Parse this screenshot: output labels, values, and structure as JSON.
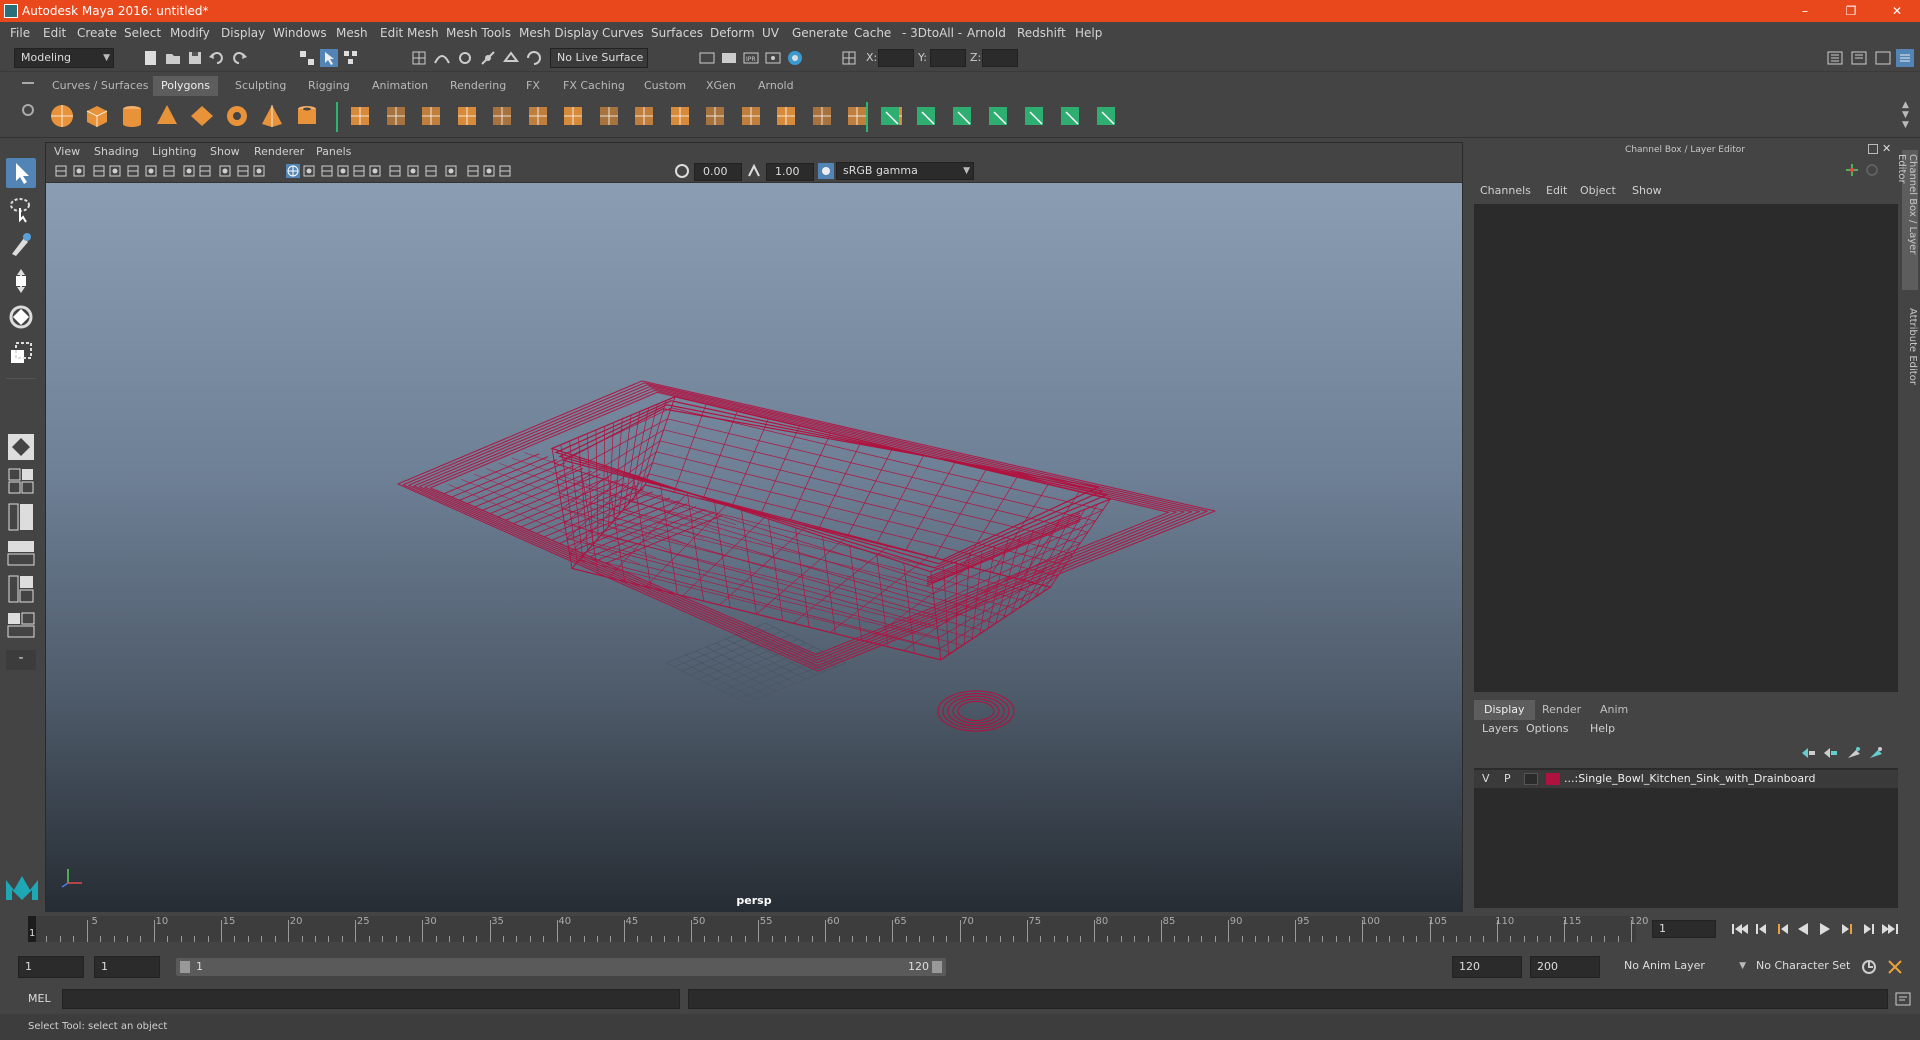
{
  "window": {
    "title": "Autodesk Maya 2016: untitled*",
    "controls": [
      "–",
      "❐",
      "✕"
    ]
  },
  "menubar": [
    "File",
    "Edit",
    "Create",
    "Select",
    "Modify",
    "Display",
    "Windows",
    "Mesh",
    "Edit Mesh",
    "Mesh Tools",
    "Mesh Display",
    "Curves",
    "Surfaces",
    "Deform",
    "UV",
    "Generate",
    "Cache",
    "- 3DtoAll -",
    "Arnold",
    "Redshift",
    "Help"
  ],
  "statusline": {
    "menuset": "Modeling",
    "live_surface": "No Live Surface",
    "x_label": "X:",
    "y_label": "Y:",
    "z_label": "Z:"
  },
  "shelf_tabs": [
    "Curves / Surfaces",
    "Polygons",
    "Sculpting",
    "Rigging",
    "Animation",
    "Rendering",
    "FX",
    "FX Caching",
    "Custom",
    "XGen",
    "Arnold"
  ],
  "shelf_active": "Polygons",
  "shelf_icon_names": [
    "sphere-icon",
    "cube-icon",
    "cylinder-icon",
    "cone-icon",
    "plane-icon",
    "torus-icon",
    "pyramid-icon",
    "pipe-icon",
    "combine-icon",
    "separate-icon",
    "extract-icon",
    "smooth-icon",
    "boolean-icon",
    "mirror-icon",
    "bevel-icon",
    "bridge-icon",
    "extrude-icon",
    "multicut-icon",
    "insert-edge-loop-icon",
    "append-icon",
    "fill-hole-icon",
    "target-weld-icon",
    "quad-draw-icon",
    "crease-icon",
    "uv-planar-icon",
    "uv-auto-icon",
    "uv-cylindrical-icon",
    "uv-spherical-icon",
    "uv-editor-icon",
    "uv-unfold-icon",
    "uv-layout-icon"
  ],
  "viewport": {
    "menu": [
      "View",
      "Shading",
      "Lighting",
      "Show",
      "Renderer",
      "Panels"
    ],
    "exposure": "0.00",
    "gamma": "1.00",
    "color_space": "sRGB gamma",
    "camera_label": "persp",
    "wire_color": "#b0123f"
  },
  "right_panel": {
    "header": "Channel Box / Layer Editor",
    "menu": [
      "Channels",
      "Edit",
      "Object",
      "Show"
    ],
    "tabs": [
      "Display",
      "Render",
      "Anim"
    ],
    "active_tab": "Display",
    "layer_menu": [
      "Layers",
      "Options",
      "Help"
    ],
    "layer": {
      "visible": "V",
      "playback": "P",
      "color": "#b0123f",
      "name": "...:Single_Bowl_Kitchen_Sink_with_Drainboard"
    },
    "side_tabs": [
      "Channel Box / Layer Editor",
      "Attribute Editor"
    ]
  },
  "timeline": {
    "ticks": [
      "5",
      "10",
      "15",
      "20",
      "25",
      "30",
      "35",
      "40",
      "45",
      "50",
      "55",
      "60",
      "65",
      "70",
      "75",
      "80",
      "85",
      "90",
      "95",
      "100",
      "105",
      "110",
      "115",
      "120"
    ],
    "start_label": "1",
    "current_frame": "1"
  },
  "range": {
    "start": "1",
    "playback_start": "1",
    "slider_start": "1",
    "slider_end": "120",
    "playback_end": "120",
    "end": "200",
    "anim_layer": "No Anim Layer",
    "character_set": "No Character Set"
  },
  "command": {
    "label": "MEL",
    "help_text": "Select Tool: select an object"
  }
}
